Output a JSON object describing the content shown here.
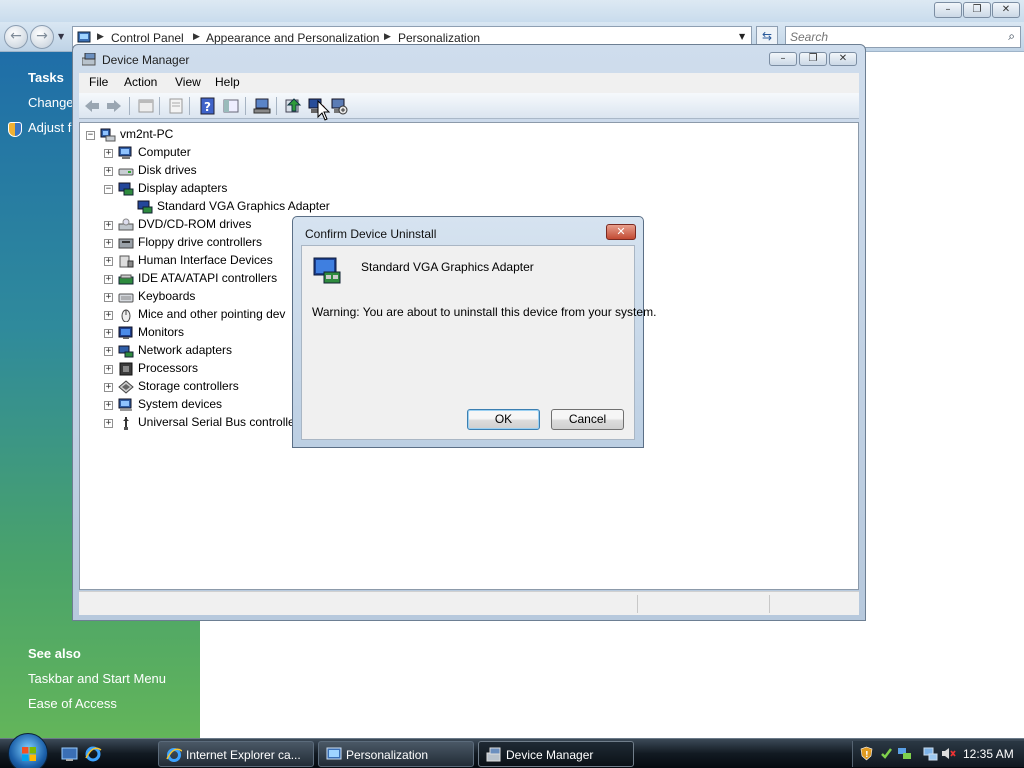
{
  "explorer": {
    "search_placeholder": "Search",
    "breadcrumbs": [
      "Control Panel",
      "Appearance and Personalization",
      "Personalization"
    ],
    "sidebar": {
      "tasks_heading": "Tasks",
      "tasks": [
        "Change",
        "Adjust fo"
      ],
      "see_also_heading": "See also",
      "see_also": [
        "Taskbar and Start Menu",
        "Ease of Access"
      ]
    }
  },
  "device_manager": {
    "title": "Device Manager",
    "menu": [
      "File",
      "Action",
      "View",
      "Help"
    ],
    "tree": {
      "root": "vm2nt-PC",
      "categories": [
        {
          "label": "Computer",
          "expanded": false,
          "icon": "computer-icon"
        },
        {
          "label": "Disk drives",
          "expanded": false,
          "icon": "disk-drive-icon"
        },
        {
          "label": "Display adapters",
          "expanded": true,
          "icon": "display-adapter-icon",
          "children": [
            "Standard VGA Graphics Adapter"
          ]
        },
        {
          "label": "DVD/CD-ROM drives",
          "expanded": false,
          "icon": "dvd-drive-icon"
        },
        {
          "label": "Floppy drive controllers",
          "expanded": false,
          "icon": "floppy-controller-icon"
        },
        {
          "label": "Human Interface Devices",
          "expanded": false,
          "icon": "hid-icon"
        },
        {
          "label": "IDE ATA/ATAPI controllers",
          "expanded": false,
          "icon": "ide-controller-icon"
        },
        {
          "label": "Keyboards",
          "expanded": false,
          "icon": "keyboard-icon"
        },
        {
          "label": "Mice and other pointing dev",
          "expanded": false,
          "icon": "mouse-icon"
        },
        {
          "label": "Monitors",
          "expanded": false,
          "icon": "monitor-icon"
        },
        {
          "label": "Network adapters",
          "expanded": false,
          "icon": "network-adapter-icon"
        },
        {
          "label": "Processors",
          "expanded": false,
          "icon": "processor-icon"
        },
        {
          "label": "Storage controllers",
          "expanded": false,
          "icon": "storage-controller-icon"
        },
        {
          "label": "System devices",
          "expanded": false,
          "icon": "system-device-icon"
        },
        {
          "label": "Universal Serial Bus controlle",
          "expanded": false,
          "icon": "usb-icon"
        }
      ]
    }
  },
  "dialog": {
    "title": "Confirm Device Uninstall",
    "close_label": "✕",
    "device_name": "Standard VGA Graphics Adapter",
    "warning": "Warning: You are about to uninstall this device from your system.",
    "ok_label": "OK",
    "cancel_label": "Cancel"
  },
  "taskbar": {
    "buttons": [
      {
        "label": "Internet Explorer ca...",
        "active": false,
        "icon": "ie-icon"
      },
      {
        "label": "Personalization",
        "active": false,
        "icon": "control-panel-icon"
      },
      {
        "label": "Device Manager",
        "active": true,
        "icon": "device-manager-icon"
      }
    ],
    "clock": "12:35 AM"
  },
  "colors": {
    "sidebar_top": "#1f6ea8",
    "sidebar_bottom": "#63b55a",
    "taskbar": "#121a22",
    "window_chrome": "#c9dced"
  }
}
